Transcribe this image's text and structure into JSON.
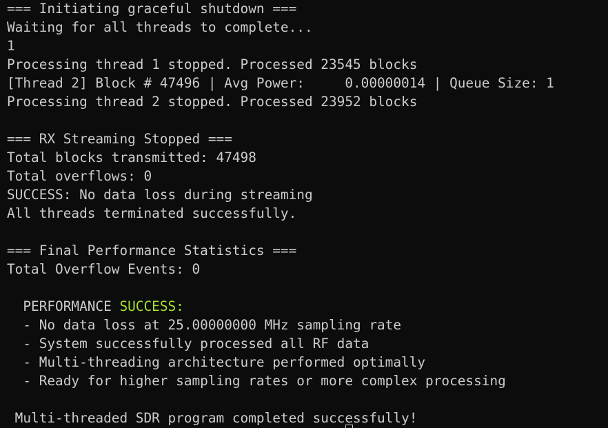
{
  "terminal": {
    "lines": [
      "=== Initiating graceful shutdown ===",
      "Waiting for all threads to complete...",
      "1",
      "Processing thread 1 stopped. Processed 23545 blocks",
      "[Thread 2] Block # 47496 | Avg Power:     0.00000014 | Queue Size: 1",
      "Processing thread 2 stopped. Processed 23952 blocks",
      "",
      "=== RX Streaming Stopped ===",
      "Total blocks transmitted: 47498",
      "Total overflows: 0",
      "SUCCESS: No data loss during streaming",
      "All threads terminated successfully.",
      "",
      "=== Final Performance Statistics ===",
      "Total Overflow Events: 0",
      ""
    ],
    "perf_prefix": "  PERFORMANCE ",
    "perf_success": "SUCCESS:",
    "perf_lines": [
      "  - No data loss at 25.00000000 MHz sampling rate",
      "  - System successfully processed all RF data",
      "  - Multi-threading architecture performed optimally",
      "  - Ready for higher sampling rates or more complex processing",
      ""
    ],
    "final_line": " Multi-threaded SDR program completed successfully!",
    "colors": {
      "background": "#0c0c0c",
      "foreground": "#cccccc",
      "success": "#a6e22e"
    }
  }
}
